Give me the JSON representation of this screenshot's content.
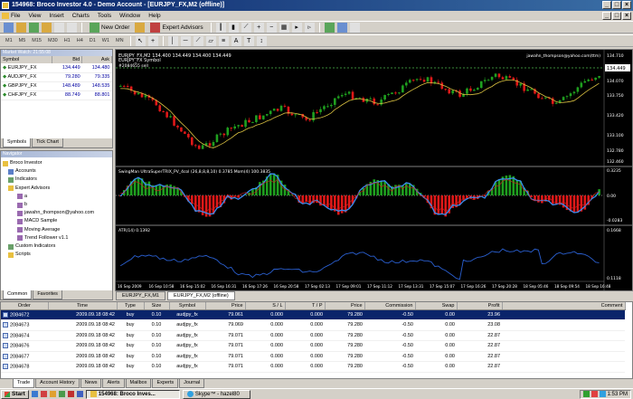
{
  "window": {
    "title": "154968: Broco Investor 4.0 - Demo Account - [EURJPY_FX,M2 (offline)]"
  },
  "menu": [
    "File",
    "View",
    "Insert",
    "Charts",
    "Tools",
    "Window",
    "Help"
  ],
  "toolbar": {
    "new_order": "New Order",
    "expert_advisors": "Expert Advisors",
    "timeframes": [
      "M1",
      "M5",
      "M15",
      "M30",
      "H1",
      "H4",
      "D1",
      "W1",
      "MN"
    ]
  },
  "market_watch": {
    "title": "Market Watch: 21:55:08",
    "headers": [
      "Symbol",
      "Bid",
      "Ask"
    ],
    "rows": [
      {
        "symbol": "EURJPY_FX",
        "bid": "134.449",
        "ask": "134.480"
      },
      {
        "symbol": "AUDJPY_FX",
        "bid": "79.280",
        "ask": "79.335"
      },
      {
        "symbol": "GBPJPY_FX",
        "bid": "148.489",
        "ask": "148.535"
      },
      {
        "symbol": "CHFJPY_FX",
        "bid": "88.749",
        "ask": "88.801"
      }
    ],
    "tabs": [
      "Symbols",
      "Tick Chart"
    ]
  },
  "navigator": {
    "title": "Navigator",
    "items": [
      "Broco Investor",
      "Accounts",
      "Indicators",
      "Expert Advisors",
      "a",
      "b",
      "jawahn_thompson@yahoo.com",
      "MACD Sample",
      "Moving Average",
      "Trend Follower v1.1",
      "Custom Indicators",
      "Scripts"
    ],
    "tabs": [
      "Common",
      "Favorites"
    ]
  },
  "chart": {
    "header1": "EURJPY_FX,M2  134.400 134.449 134.400 134.449",
    "header2": "EURJPY_FX Symbol",
    "order_line": "#2084655 sell",
    "owner": "jawahn_thompson@yahoo.com(ttm)",
    "price_label": "134.449",
    "price_scale": [
      "134.710",
      "134.070",
      "133.750",
      "133.420",
      "133.100",
      "132.780",
      "132.460"
    ],
    "ind1": "SwingMan UltraSuperTRIX_PV_4col (26,8,8,8,10) 0.3785  Mom(4) 100.3835",
    "ind1_scale": [
      "0.3235",
      "0.00",
      "-0.0283"
    ],
    "ind2": "ATR(14) 0.1392",
    "ind2_scale": [
      "0.1668",
      "0.1118"
    ],
    "time_labels": [
      "16 Sep 2009",
      "16 Sep 10:58",
      "16 Sep 15:02",
      "16 Sep 16:31",
      "16 Sep 17:26",
      "16 Sep 20:58",
      "17 Sep 02:13",
      "17 Sep 09:01",
      "17 Sep 11:12",
      "17 Sep 13:31",
      "17 Sep 15:07",
      "17 Sep 16:26",
      "17 Sep 20:28",
      "18 Sep 05:46",
      "18 Sep 09:54",
      "18 Sep 16:48"
    ],
    "tabs": [
      "EURJPY_FX,M1",
      "EURJPY_FX,M2 (offline)"
    ]
  },
  "terminal": {
    "headers": [
      "Order",
      "Time",
      "Type",
      "Size",
      "Symbol",
      "Price",
      "S / L",
      "T / P",
      "Price",
      "Commission",
      "Swap",
      "Profit",
      "Comment"
    ],
    "rows": [
      [
        "2084672",
        "2009.09.18 08:42",
        "buy",
        "0.10",
        "audjpy_fx",
        "79.061",
        "0.000",
        "0.000",
        "79.280",
        "-0.50",
        "0.00",
        "23.96",
        ""
      ],
      [
        "2084673",
        "2009.09.18 08:42",
        "buy",
        "0.10",
        "audjpy_fx",
        "79.069",
        "0.000",
        "0.000",
        "79.280",
        "-0.50",
        "0.00",
        "23.08",
        ""
      ],
      [
        "2084674",
        "2009.09.18 08:42",
        "buy",
        "0.10",
        "audjpy_fx",
        "79.071",
        "0.000",
        "0.000",
        "79.280",
        "-0.50",
        "0.00",
        "22.87",
        ""
      ],
      [
        "2084676",
        "2009.09.18 08:42",
        "buy",
        "0.10",
        "audjpy_fx",
        "79.071",
        "0.000",
        "0.000",
        "79.280",
        "-0.50",
        "0.00",
        "22.87",
        ""
      ],
      [
        "2084677",
        "2009.09.18 08:42",
        "buy",
        "0.10",
        "audjpy_fx",
        "79.071",
        "0.000",
        "0.000",
        "79.280",
        "-0.50",
        "0.00",
        "22.87",
        ""
      ],
      [
        "2084678",
        "2009.09.18 08:42",
        "buy",
        "0.10",
        "audjpy_fx",
        "79.071",
        "0.000",
        "0.000",
        "79.280",
        "-0.50",
        "0.00",
        "22.87",
        ""
      ]
    ],
    "tabs": [
      "Trade",
      "Account History",
      "News",
      "Alerts",
      "Mailbox",
      "Experts",
      "Journal"
    ]
  },
  "taskbar": {
    "start": "Start",
    "task1": "154968: Broco Inves...",
    "task2": "Skype™ - hazel80",
    "clock": "1:53 PM"
  },
  "colors": {
    "up": "#1fa01f",
    "down": "#e01818",
    "ma": "#d9c040",
    "macd": "#3a8df0",
    "atr": "#2a5fd0"
  }
}
